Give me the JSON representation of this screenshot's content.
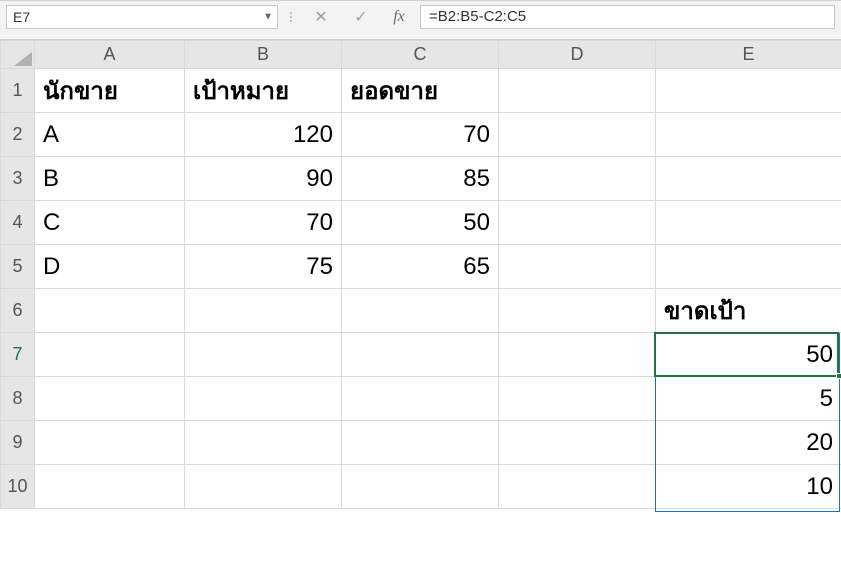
{
  "namebox": {
    "value": "E7"
  },
  "formula_bar": {
    "cancel_glyph": "✕",
    "enter_glyph": "✓",
    "fx_label": "fx",
    "formula": "=B2:B5-C2:C5"
  },
  "columns": [
    "A",
    "B",
    "C",
    "D",
    "E"
  ],
  "row_numbers": [
    "1",
    "2",
    "3",
    "4",
    "5",
    "6",
    "7",
    "8",
    "9",
    "10"
  ],
  "active_row": "7",
  "headers": {
    "A": "นักขาย",
    "B": "เป้าหมาย",
    "C": "ยอดขาย"
  },
  "data_rows": [
    {
      "A": "A",
      "B": "120",
      "C": "70"
    },
    {
      "A": "B",
      "B": "90",
      "C": "85"
    },
    {
      "A": "C",
      "B": "70",
      "C": "50"
    },
    {
      "A": "D",
      "B": "75",
      "C": "65"
    }
  ],
  "e6_label": "ขาดเป้า",
  "e_results": [
    "50",
    "5",
    "20",
    "10"
  ]
}
